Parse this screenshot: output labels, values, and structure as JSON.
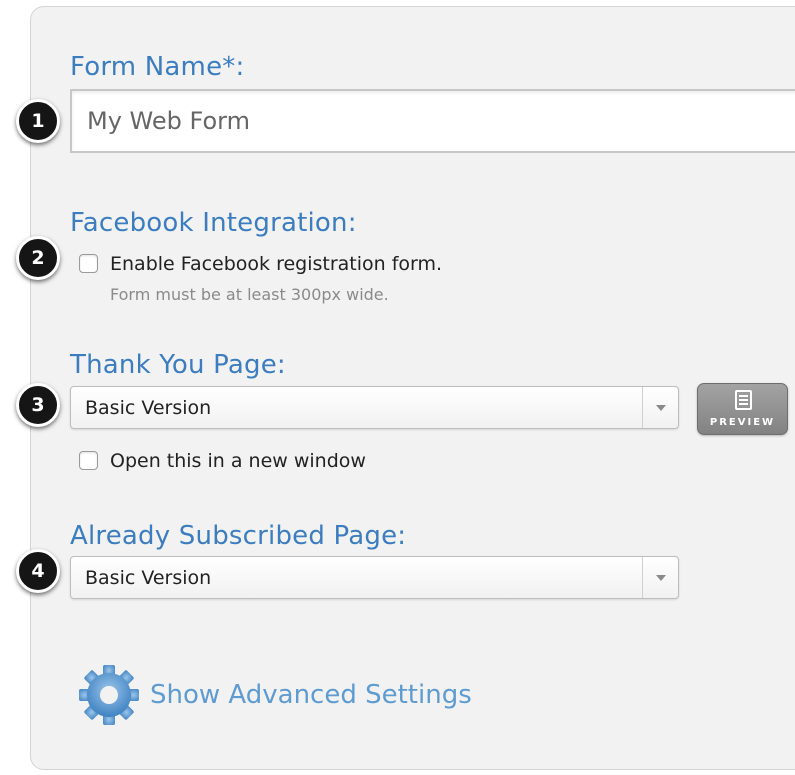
{
  "form_name": {
    "label": "Form Name*:",
    "value": "My Web Form",
    "step": "1"
  },
  "facebook": {
    "label": "Facebook Integration:",
    "checkbox_label": "Enable Facebook registration form.",
    "hint": "Form must be at least 300px wide.",
    "checked": false,
    "step": "2"
  },
  "thank_you": {
    "label": "Thank You Page:",
    "selected": "Basic Version",
    "preview_label": "PREVIEW",
    "new_window_label": "Open this in a new window",
    "new_window_checked": false,
    "step": "3"
  },
  "already_subscribed": {
    "label": "Already Subscribed Page:",
    "selected": "Basic Version",
    "step": "4"
  },
  "advanced": {
    "label": "Show Advanced Settings",
    "icon": "gear-icon"
  },
  "colors": {
    "label_blue": "#3b7dbf",
    "link_blue": "#5e9bd0",
    "panel_bg": "#f2f2f2"
  }
}
